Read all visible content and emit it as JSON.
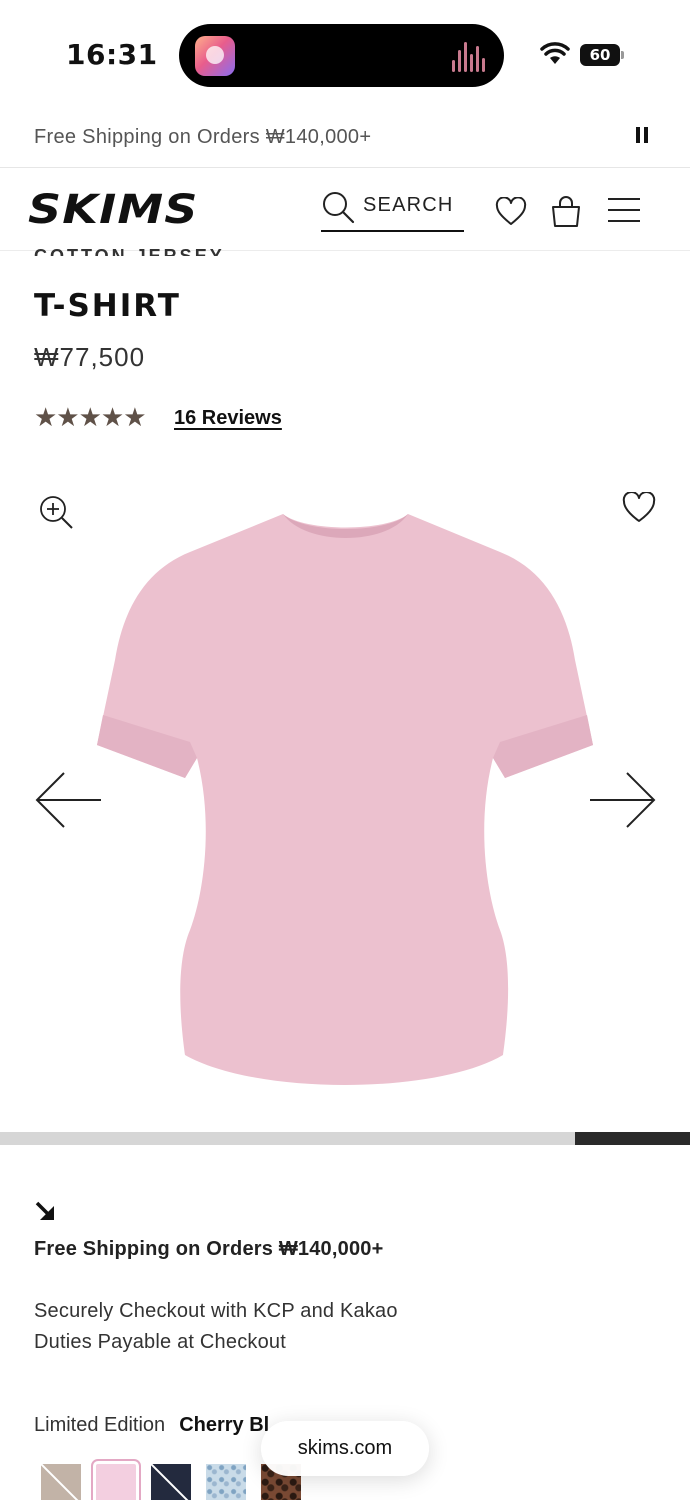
{
  "status": {
    "time": "16:31",
    "battery": "60"
  },
  "promo": {
    "text": "Free Shipping on Orders ₩140,000+"
  },
  "header": {
    "logo": "SKIMS",
    "search_label": "SEARCH"
  },
  "product": {
    "category": "COTTON JERSEY",
    "title": "T-SHIRT",
    "price": "₩77,500",
    "rating": 5,
    "stars": "★★★★★",
    "reviews_label": "16 Reviews",
    "garment_color": "#ecc1cf"
  },
  "gallery": {
    "progress": 0.167
  },
  "info": {
    "shipping": "Free Shipping on Orders ₩140,000+",
    "checkout": "Securely Checkout with KCP and Kakao",
    "duties": "Duties Payable at Checkout"
  },
  "color": {
    "label": "Limited Edition",
    "name": "Cherry Bl",
    "swatches": [
      {
        "color": "#c2b3a7",
        "unavailable": true
      },
      {
        "color": "#f3cfe0",
        "selected": true
      },
      {
        "color": "#232a3e",
        "unavailable": true
      },
      {
        "color": "#c9dbe8",
        "pattern": "floral"
      },
      {
        "color": "#7a4a34",
        "pattern": "leopard"
      }
    ]
  },
  "browser": {
    "url": "skims.com"
  }
}
